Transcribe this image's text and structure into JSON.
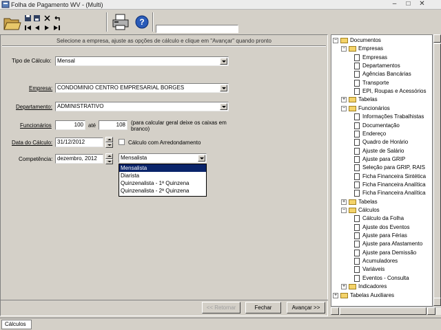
{
  "window": {
    "title": "Folha de Pagamento WV - (Multi)",
    "minimize": "–",
    "maximize": "□",
    "close": "✕"
  },
  "toolbar": {
    "icons": [
      "folder-open-icon",
      "save-icon",
      "cut-icon",
      "undo-icon",
      "first-icon",
      "prev-icon",
      "next-icon",
      "last-icon",
      "print-icon",
      "help-icon"
    ]
  },
  "main": {
    "instruction": "Selecione a empresa, ajuste as opções de cálculo e clique em \"Avançar\" quando pronto",
    "tipo_calculo": {
      "label": "Tipo de Cálculo:",
      "value": "Mensal"
    },
    "empresa": {
      "label": "Empresa:",
      "value": "CONDOMINIO CENTRO EMPRESARIAL BORGES"
    },
    "departamento": {
      "label": "Departamento:",
      "value": "ADMINISTRATIVO"
    },
    "funcionarios": {
      "label": "Funcionários",
      "from": "100",
      "ate_label": "até",
      "to": "108",
      "hint": "(para calcular geral deixe os caixas em branco)"
    },
    "data_calculo": {
      "label": "Data do Cálculo:",
      "value": "31/12/2012"
    },
    "arredondamento": {
      "label": "Cálculo com Arredondamento",
      "checked": false
    },
    "competencia": {
      "label": "Competência:",
      "value": "dezembro, 2012"
    },
    "tipo_folha": {
      "value": "Mensalista",
      "options": [
        "Mensalista",
        "Diarista",
        "Quinzenalista - 1ª Quinzena",
        "Quinzenalista - 2ª Quinzena"
      ],
      "selected_index": 0
    },
    "buttons": {
      "retornar": "<< Retornar",
      "fechar": "Fechar",
      "avancar": "Avançar >>"
    }
  },
  "tree": {
    "nodes": [
      {
        "label": "Documentos",
        "type": "folder",
        "expanded": true,
        "level": 0
      },
      {
        "label": "Empresas",
        "type": "folder",
        "expanded": true,
        "level": 1
      },
      {
        "label": "Empresas",
        "type": "doc",
        "level": 2
      },
      {
        "label": "Departamentos",
        "type": "doc",
        "level": 2
      },
      {
        "label": "Agências Bancárias",
        "type": "doc",
        "level": 2
      },
      {
        "label": "Transporte",
        "type": "doc",
        "level": 2
      },
      {
        "label": "EPI, Roupas e Acessórios",
        "type": "doc",
        "level": 2
      },
      {
        "label": "Tabelas",
        "type": "folder",
        "expanded": false,
        "level": 1
      },
      {
        "label": "Funcionários",
        "type": "folder",
        "expanded": true,
        "level": 1
      },
      {
        "label": "Informações Trabalhistas",
        "type": "doc",
        "level": 2
      },
      {
        "label": "Documentação",
        "type": "doc",
        "level": 2
      },
      {
        "label": "Endereço",
        "type": "doc",
        "level": 2
      },
      {
        "label": "Quadro de Horário",
        "type": "doc",
        "level": 2
      },
      {
        "label": "Ajuste de Salário",
        "type": "doc",
        "level": 2
      },
      {
        "label": "Ajuste para GRIP",
        "type": "doc",
        "level": 2
      },
      {
        "label": "Seleção para GRIP, RAIS",
        "type": "doc",
        "level": 2
      },
      {
        "label": "Ficha Financeira Sintética",
        "type": "doc",
        "level": 2
      },
      {
        "label": "Ficha Financeira Analítica",
        "type": "doc",
        "level": 2
      },
      {
        "label": "Ficha Financeira Analítica",
        "type": "doc",
        "level": 2
      },
      {
        "label": "Tabelas",
        "type": "folder",
        "expanded": false,
        "level": 1
      },
      {
        "label": "Cálculos",
        "type": "folder",
        "expanded": true,
        "level": 1
      },
      {
        "label": "Cálculo da Folha",
        "type": "doc",
        "level": 2
      },
      {
        "label": "Ajuste dos Eventos",
        "type": "doc",
        "level": 2
      },
      {
        "label": "Ajuste para Férias",
        "type": "doc",
        "level": 2
      },
      {
        "label": "Ajuste para Afastamento",
        "type": "doc",
        "level": 2
      },
      {
        "label": "Ajuste para Demissão",
        "type": "doc",
        "level": 2
      },
      {
        "label": "Acumuladores",
        "type": "doc",
        "level": 2
      },
      {
        "label": "Variáveis",
        "type": "doc",
        "level": 2
      },
      {
        "label": "Eventos - Consulta",
        "type": "doc",
        "level": 2
      },
      {
        "label": "Indicadores",
        "type": "folder",
        "expanded": false,
        "level": 1
      },
      {
        "label": "Tabelas Auxiliares",
        "type": "folder",
        "expanded": false,
        "level": 0
      }
    ]
  },
  "statusbar": {
    "tab": "Cálculos"
  }
}
